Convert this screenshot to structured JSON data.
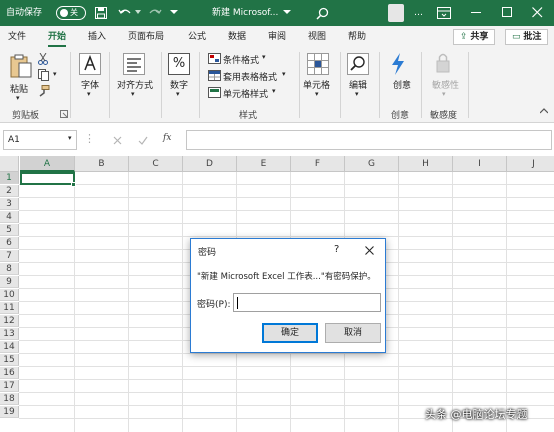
{
  "titlebar": {
    "autosave_label": "自动保存",
    "autosave_state": "关",
    "title": "新建 Microsof...",
    "overflow_label": "…"
  },
  "tabs": [
    "文件",
    "开始",
    "插入",
    "页面布局",
    "公式",
    "数据",
    "审阅",
    "视图",
    "帮助"
  ],
  "share_label": "共享",
  "comments_label": "批注",
  "ribbon": {
    "paste": "粘贴",
    "clipboard": "剪贴板",
    "font": "字体",
    "alignment": "对齐方式",
    "number": "数字",
    "percent": "%",
    "cond_format": "条件格式",
    "table_format": "套用表格格式",
    "cell_styles": "单元格样式",
    "styles_group": "样式",
    "cells": "单元格",
    "editing": "编辑",
    "creativity_btn": "创意",
    "creativity_group": "创意",
    "sensitivity_btn": "敏感性",
    "sensitivity_group": "敏感度"
  },
  "formula_bar": {
    "name_box": "A1",
    "fx": "fx"
  },
  "columns": [
    "A",
    "B",
    "C",
    "D",
    "E",
    "F",
    "G",
    "H",
    "I",
    "J"
  ],
  "rows": [
    "1",
    "2",
    "3",
    "4",
    "5",
    "6",
    "7",
    "8",
    "9",
    "10",
    "11",
    "12",
    "13",
    "14",
    "15",
    "16",
    "17",
    "18",
    "19"
  ],
  "dialog": {
    "title": "密码",
    "help": "?",
    "message": "\"新建 Microsoft Excel 工作表...\"有密码保护。",
    "field_label": "密码(P):",
    "password_value": "",
    "ok": "确定",
    "cancel": "取消"
  },
  "watermark": "头条 @电脑论坛专题",
  "colors": {
    "accent": "#217346",
    "dialog_border": "#2b7bd3"
  }
}
